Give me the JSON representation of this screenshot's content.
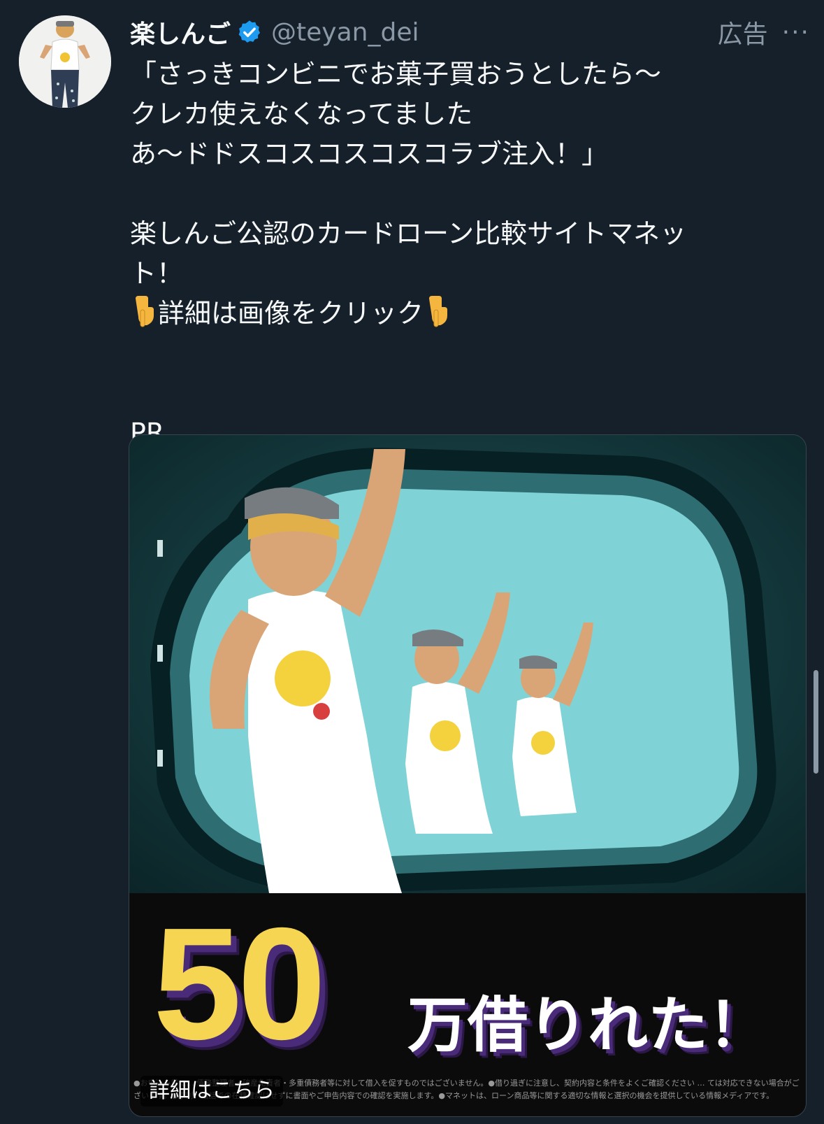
{
  "author": {
    "display_name": "楽しんご",
    "handle": "@teyan_dei",
    "verified_icon": "verified-badge-icon"
  },
  "meta": {
    "ad_label": "広告",
    "more_label": "···"
  },
  "tweet": {
    "lines": [
      "「さっきコンビニでお菓子買おうとしたら〜",
      "クレカ使えなくなってました",
      "あ〜ドドスコスコスコスコラブ注入！」",
      "",
      "楽しんご公認のカードローン比較サイトマネッ",
      "ト！",
      "",
      "",
      "",
      "PR"
    ],
    "cta_text": "詳細は画像をクリック",
    "cta_icon": "pointing-down-icon"
  },
  "media": {
    "big_number": "50",
    "tagline": "万借りれた！",
    "fine_print": "●お申込み前に… 債務整理者・破産免責者・多重債務者等に対して借入を促すものではございません。●借り過ぎに注意し、契約内容と条件をよくご確認ください … ては対応できない場合がございます。●原則、電話での在籍確認はせずに書面やご申告内容での確認を実施します。●マネットは、ローン商品等に関する適切な情報と選択の機会を提供している情報メディアです。",
    "detail_label": "詳細はこちら"
  },
  "colors": {
    "background": "#15202b",
    "text": "#f7f9f9",
    "secondary": "#8b98a5",
    "verified": "#1d9bf0",
    "number_yellow": "#f6d552"
  }
}
